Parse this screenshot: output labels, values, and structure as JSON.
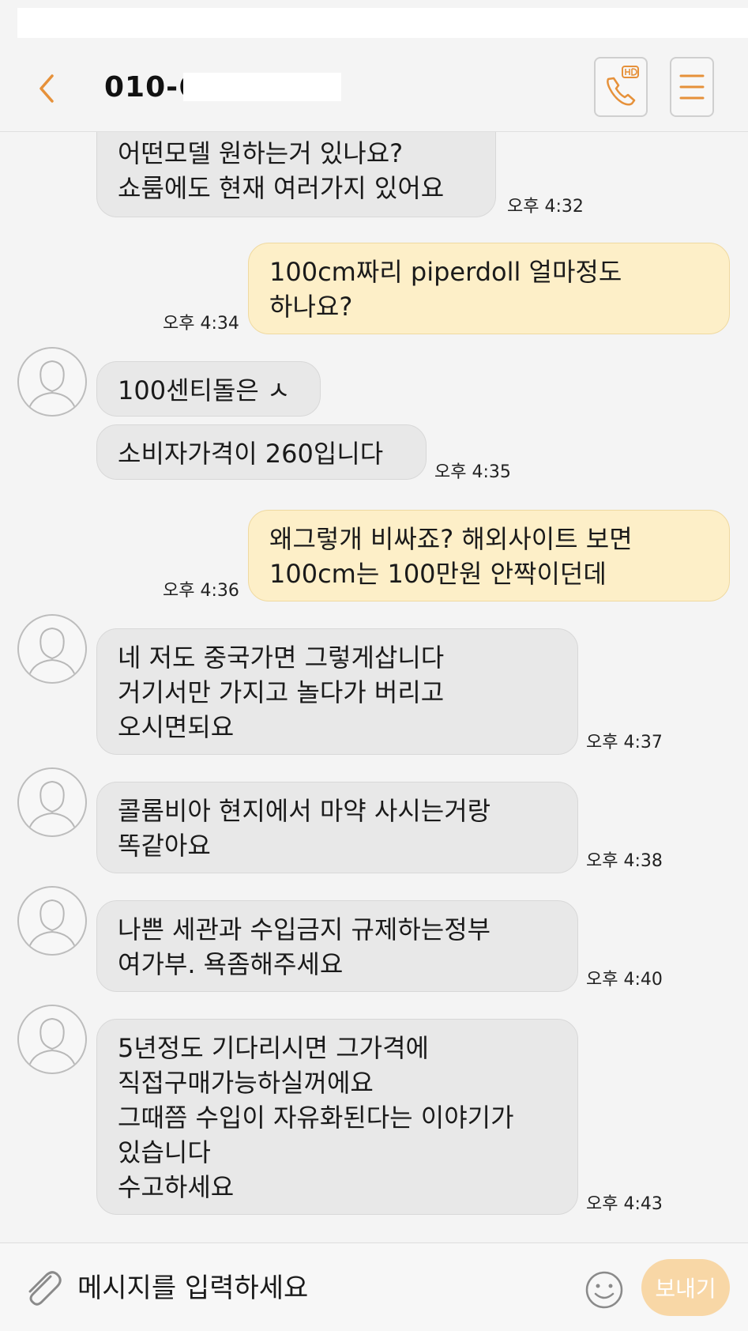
{
  "header": {
    "title": "010-6",
    "icons": {
      "back": "chevron-left-icon",
      "call": "hd-call-icon",
      "menu": "menu-icon"
    }
  },
  "messages": [
    {
      "id": "m1",
      "direction": "incoming",
      "text": "어떤모델 원하는거 있나요?\n쇼룸에도 현재 여러가지 있어요",
      "time": "오후 4:32"
    },
    {
      "id": "m2",
      "direction": "outgoing",
      "text": "100cm짜리 piperdoll 얼마정도\n하나요?",
      "time": "오후 4:34"
    },
    {
      "id": "m3",
      "direction": "incoming",
      "text": "100센티돌은 ㅅ",
      "time": ""
    },
    {
      "id": "m4",
      "direction": "incoming",
      "text": "소비자가격이 260입니다",
      "time": "오후 4:35"
    },
    {
      "id": "m5",
      "direction": "outgoing",
      "text": "왜그렇개 비싸죠? 해외사이트 보면\n100cm는 100만원 안짝이던데",
      "time": "오후 4:36"
    },
    {
      "id": "m6",
      "direction": "incoming",
      "text": "네 저도 중국가면 그렇게삽니다\n거기서만 가지고 놀다가 버리고\n오시면되요",
      "time": "오후 4:37"
    },
    {
      "id": "m7",
      "direction": "incoming",
      "text": "콜롬비아 현지에서 마약 사시는거랑\n똑같아요",
      "time": "오후 4:38"
    },
    {
      "id": "m8",
      "direction": "incoming",
      "text": "나쁜 세관과 수입금지 규제하는정부\n여가부. 욕좀해주세요",
      "time": "오후 4:40"
    },
    {
      "id": "m9",
      "direction": "incoming",
      "text": "5년정도 기다리시면 그가격에\n직접구매가능하실꺼에요\n그때쯤 수입이 자유화된다는 이야기가\n있습니다\n수고하세요",
      "time": "오후 4:43"
    }
  ],
  "input_bar": {
    "placeholder": "메시지를 입력하세요",
    "send_label": "보내기",
    "icons": {
      "attach": "paperclip-icon",
      "emoji": "emoji-icon"
    }
  },
  "colors": {
    "accent": "#e6913a",
    "incoming_bubble": "#e8e8e8",
    "outgoing_bubble": "#fdefc8",
    "send_button": "#f8d7a6"
  }
}
